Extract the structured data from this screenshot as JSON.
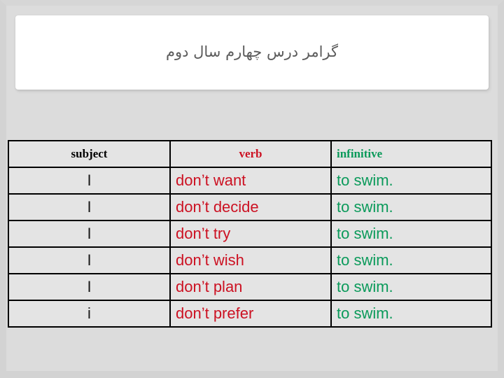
{
  "slide": {
    "title": "گرامر درس چهارم سال دوم",
    "background_color": "#dcdcdc",
    "title_panel_color": "#ffffff",
    "title_text_color": "#5b5b5b"
  },
  "table": {
    "colors": {
      "subject": "#000000",
      "verb": "#cc1122",
      "infinitive": "#0a9a5a",
      "cell_background": "#e4e4e4",
      "border": "#000000"
    },
    "headers": {
      "subject": "subject",
      "verb": "verb",
      "infinitive": "infinitive"
    },
    "rows": [
      {
        "subject": "I",
        "verb": "don’t want",
        "infinitive": "to swim."
      },
      {
        "subject": "I",
        "verb": "don’t decide",
        "infinitive": "to swim."
      },
      {
        "subject": "I",
        "verb": "don’t try",
        "infinitive": "to swim."
      },
      {
        "subject": "I",
        "verb": "don’t wish",
        "infinitive": "to swim."
      },
      {
        "subject": "I",
        "verb": "don’t plan",
        "infinitive": "to swim."
      },
      {
        "subject": "i",
        "verb": "don’t prefer",
        "infinitive": "to swim."
      }
    ]
  }
}
